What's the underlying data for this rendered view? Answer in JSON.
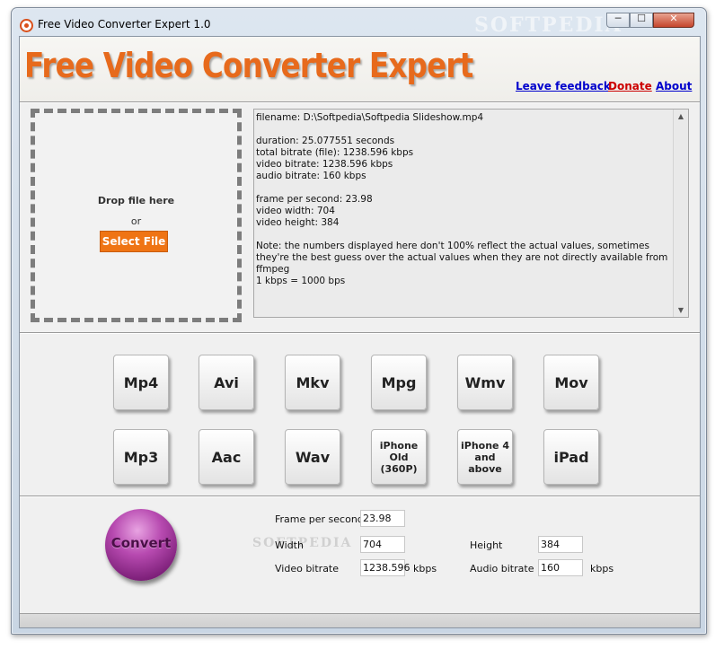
{
  "window": {
    "title": "Free Video Converter Expert 1.0",
    "watermark": "SOFTPEDIA",
    "controls": {
      "minimize": "─",
      "maximize": "☐",
      "close": "✕"
    }
  },
  "header": {
    "logo_text": "Free Video Converter Expert",
    "links": {
      "feedback": "Leave feedback",
      "donate": "Donate",
      "about": "About"
    }
  },
  "drop_zone": {
    "label": "Drop file here",
    "or": "or",
    "button": "Select File"
  },
  "file_info": {
    "lines": [
      "filename: D:\\Softpedia\\Softpedia Slideshow.mp4",
      "",
      "duration: 25.077551 seconds",
      "total bitrate (file): 1238.596 kbps",
      "video bitrate: 1238.596 kbps",
      "audio bitrate: 160 kbps",
      "",
      "frame per second: 23.98",
      "video width: 704",
      "video height: 384",
      "",
      "Note: the numbers displayed here don't 100% reflect the actual values, sometimes they're the best guess over the actual values when they are not directly available from ffmpeg",
      "1 kbps = 1000 bps"
    ]
  },
  "formats": {
    "row1": [
      "Mp4",
      "Avi",
      "Mkv",
      "Mpg",
      "Wmv",
      "Mov"
    ],
    "row2": [
      "Mp3",
      "Aac",
      "Wav",
      "iPhone Old (360P)",
      "iPhone 4 and above",
      "iPad"
    ]
  },
  "convert": {
    "label": "Convert"
  },
  "params": {
    "watermark": "SOFTPEDIA",
    "fps_label": "Frame per second",
    "fps_value": "23.98",
    "width_label": "Width",
    "width_value": "704",
    "height_label": "Height",
    "height_value": "384",
    "video_bitrate_label": "Video bitrate",
    "video_bitrate_value": "1238.596",
    "audio_bitrate_label": "Audio bitrate",
    "audio_bitrate_value": "160",
    "unit": "kbps"
  },
  "colors": {
    "logo": "#e76a1c",
    "select_button": "#ef7414",
    "convert_button": "#9b3596",
    "link_blue": "#0000cc",
    "link_red": "#cc0000"
  },
  "icons": {
    "app": "converter-app-icon",
    "scroll_up": "scroll-up-arrow-icon",
    "scroll_down": "scroll-down-arrow-icon"
  }
}
